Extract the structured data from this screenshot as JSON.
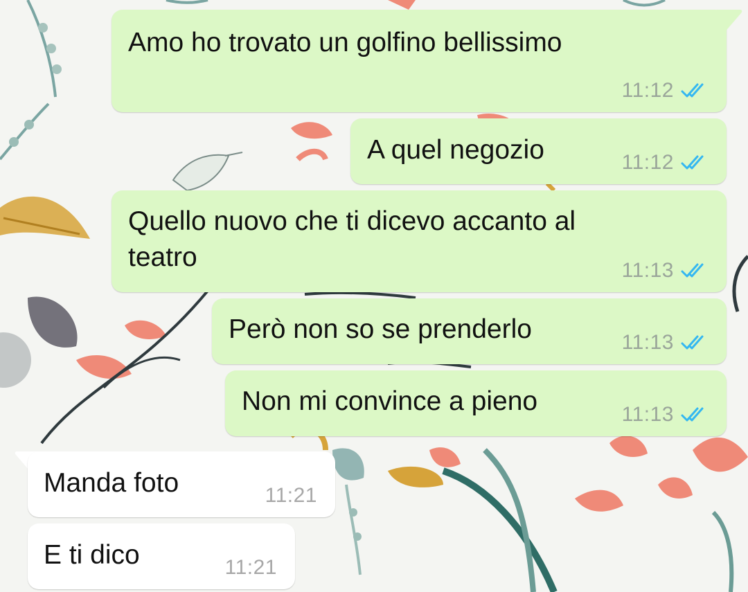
{
  "chat": {
    "messages": [
      {
        "direction": "outgoing",
        "text": "Amo ho trovato un golfino bellissimo",
        "time": "11:12",
        "status": "read"
      },
      {
        "direction": "outgoing",
        "text": "A quel negozio",
        "time": "11:12",
        "status": "read"
      },
      {
        "direction": "outgoing",
        "text": "Quello nuovo che ti dicevo accanto al\nteatro",
        "time": "11:13",
        "status": "read"
      },
      {
        "direction": "outgoing",
        "text": "Però non so se prenderlo",
        "time": "11:13",
        "status": "read"
      },
      {
        "direction": "outgoing",
        "text": "Non mi convince a pieno",
        "time": "11:13",
        "status": "read"
      },
      {
        "direction": "incoming",
        "text": "Manda foto",
        "time": "11:21"
      },
      {
        "direction": "incoming",
        "text": "E ti dico",
        "time": "11:21"
      }
    ]
  },
  "colors": {
    "outgoing_bubble": "#dcf8c6",
    "incoming_bubble": "#ffffff",
    "read_ticks": "#34b7f1",
    "wallpaper_bg": "#f4f5f2"
  },
  "icons": {
    "read_status": "double-check-icon"
  }
}
